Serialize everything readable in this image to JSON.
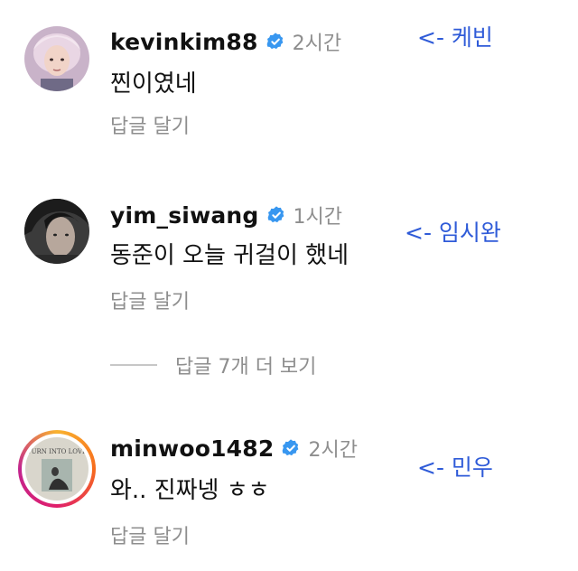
{
  "comments": [
    {
      "username": "kevinkim88",
      "time": "2시간",
      "text": "찐이였네",
      "reply_label": "답글 달기",
      "annotation": "<- 케빈"
    },
    {
      "username": "yim_siwang",
      "time": "1시간",
      "text": "동준이 오늘 귀걸이 했네",
      "reply_label": "답글 달기",
      "annotation": "<- 임시완"
    },
    {
      "username": "minwoo1482",
      "time": "2시간",
      "text": "와.. 진짜넹 ㅎㅎ",
      "reply_label": "답글 달기",
      "annotation": "<- 민우"
    }
  ],
  "more_replies_label": "답글 7개 더 보기",
  "third_avatar_caption": "TURN INTO LOVE",
  "colors": {
    "verified": "#3897f0",
    "annotation": "#2f5bd8",
    "muted": "#8e8e8e"
  },
  "icons": [
    "verified-badge-icon"
  ]
}
